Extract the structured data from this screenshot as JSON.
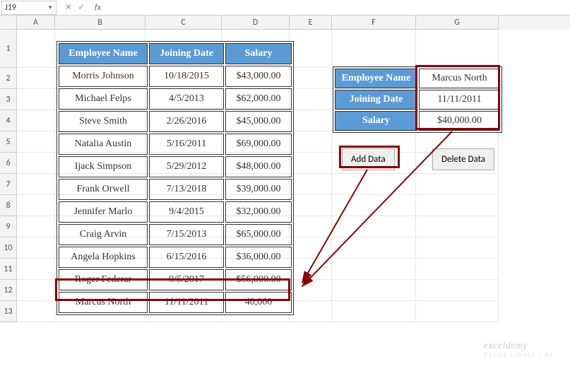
{
  "nameBox": "J19",
  "formula": "",
  "columns": [
    "A",
    "B",
    "C",
    "D",
    "E",
    "F",
    "G"
  ],
  "rowLabels": [
    "1",
    "2",
    "3",
    "4",
    "5",
    "6",
    "7",
    "8",
    "9",
    "10",
    "11",
    "12",
    "13"
  ],
  "mainTable": {
    "headers": [
      "Employee Name",
      "Joining Date",
      "Salary"
    ],
    "rows": [
      {
        "name": "Morris Johnson",
        "date": "10/18/2015",
        "salary": "$43,000.00"
      },
      {
        "name": "Michael Felps",
        "date": "4/5/2013",
        "salary": "$62,000.00"
      },
      {
        "name": "Steve Smith",
        "date": "2/26/2016",
        "salary": "$45,000.00"
      },
      {
        "name": "Natalia Austin",
        "date": "5/16/2011",
        "salary": "$69,000.00"
      },
      {
        "name": "Ijack Simpson",
        "date": "5/29/2012",
        "salary": "$48,000.00"
      },
      {
        "name": "Frank Orwell",
        "date": "7/13/2018",
        "salary": "$39,000.00"
      },
      {
        "name": "Jennifer Marlo",
        "date": "9/4/2015",
        "salary": "$32,000.00"
      },
      {
        "name": "Craig Arvin",
        "date": "7/15/2013",
        "salary": "$65,000.00"
      },
      {
        "name": "Angela Hopkins",
        "date": "6/15/2016",
        "salary": "$36,000.00"
      },
      {
        "name": "Roger Federar",
        "date": "9/5/2017",
        "salary": "$56,000.00"
      },
      {
        "name": "Marcus North",
        "date": "11/11/2011",
        "salary": "40,000"
      }
    ]
  },
  "sideTable": {
    "rows": [
      {
        "label": "Employee Name",
        "value": "Marcus North"
      },
      {
        "label": "Joining Date",
        "value": "11/11/2011"
      },
      {
        "label": "Salary",
        "value": "$40,000.00"
      }
    ]
  },
  "buttons": {
    "add": "Add Data",
    "delete": "Delete Data"
  },
  "watermark": {
    "brand": "exceldemy",
    "tagline": "EXCEL • DATA • BI"
  }
}
